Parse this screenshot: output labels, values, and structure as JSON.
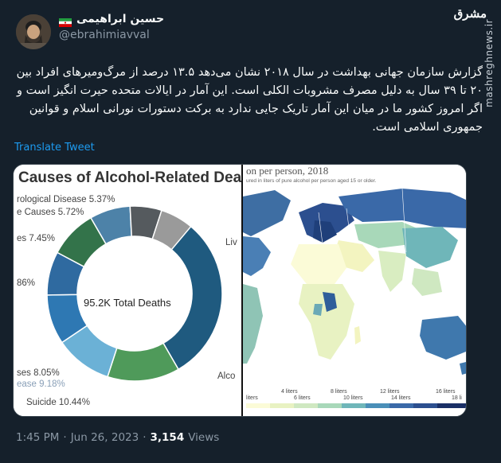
{
  "tweet": {
    "display_name": "حسین ابراهیمی",
    "handle": "@ebrahimiavval",
    "text": "گزارش سازمان جهانی بهداشت در سال ۲۰۱۸ نشان می‌دهد ۱۳.۵ درصد از مرگ‌ومیرهای افراد بین ۲۰ تا ۳۹ سال به دلیل مصرف مشروبات الکلی است. این آمار در ایالات متحده حیرت انگیز است و اگر امروز کشور ما در میان این آمار تاریک جایی ندارد به برکت دستورات نورانی اسلام و قوانین جمهوری اسلامی است.",
    "translate_label": "Translate Tweet",
    "time": "1:45 PM",
    "date": "Jun 26, 2023",
    "separator": "·",
    "views_count": "3,154",
    "views_label": "Views"
  },
  "watermark": {
    "logo": "مشرق",
    "site": "mashreghnews.ir"
  },
  "colors": {
    "background": "#15202b",
    "link": "#1d9bf0",
    "muted": "#8b98a5"
  },
  "icons": {
    "flag": "iran-flag-icon"
  },
  "media": {
    "left": {
      "title": "Causes of Alcohol-Related Deat",
      "center_text": "95.2K Total Deaths",
      "labels": {
        "neuro": "rological Disease 5.37%",
        "other": "e Causes 5.72%",
        "l745": "es 7.45%",
        "l86": "86%",
        "l805": "ses 8.05%",
        "l918": "ease 9.18%",
        "suicide": "Suicide 10.44%",
        "live": "Liv",
        "alco": "Alco"
      }
    },
    "right": {
      "title": "on per person, 2018",
      "subtitle": "ured in liters of pure alcohol per person aged 15 or older.",
      "legend": [
        "liters",
        "4 liters",
        "6 liters",
        "8 liters",
        "10 liters",
        "12 liters",
        "14 liters",
        "16 liters",
        "18 li"
      ]
    }
  },
  "chart_data": {
    "type": "pie",
    "title": "Causes of Alcohol-Related Deat",
    "center_text": "95.2K Total Deaths",
    "slices": [
      {
        "label": "Liv",
        "value": null
      },
      {
        "label": "Alco",
        "value": null
      },
      {
        "label": "Suicide",
        "value": 10.44
      },
      {
        "label": "ease",
        "value": 9.18
      },
      {
        "label": "ses",
        "value": 8.05
      },
      {
        "label": "",
        "value": null
      },
      {
        "label": "es",
        "value": 7.45
      },
      {
        "label": "e Causes",
        "value": 5.72
      },
      {
        "label": "rological Disease",
        "value": 5.37
      }
    ]
  }
}
